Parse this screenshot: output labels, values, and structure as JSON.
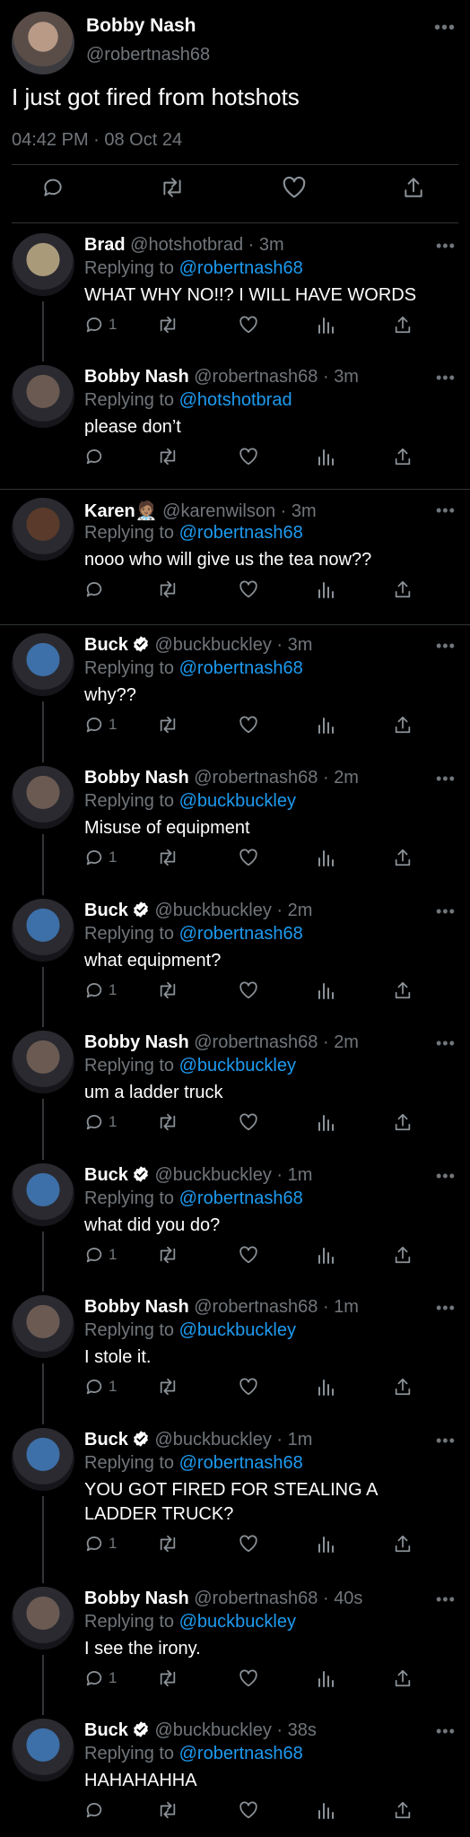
{
  "main_tweet": {
    "name": "Bobby Nash",
    "handle": "@robertnash68",
    "text": "I just got fired from hotshots",
    "timestamp": "04:42 PM · 08 Oct 24",
    "actions": [
      "reply-icon",
      "retweet-icon",
      "like-icon",
      "share-icon"
    ]
  },
  "replies": [
    {
      "name": "Brad",
      "handle": "@hotshotbrad · 3m",
      "verified": false,
      "reply_prefix": "Replying to ",
      "reply_to": "@robertnash68",
      "text": "WHAT WHY NO!!? I WILL HAVE WORDS",
      "reply_count": "1",
      "avatar_color": "#a99a7a"
    },
    {
      "name": "Bobby Nash",
      "handle": "@robertnash68 · 3m",
      "verified": false,
      "reply_prefix": "Replying to ",
      "reply_to": "@hotshotbrad",
      "text": "please don’t",
      "reply_count": "",
      "avatar_color": "#6a5a52"
    },
    {
      "name": "Karen",
      "emoji": "🧑🏽‍⚕️",
      "handle": "@karenwilson · 3m",
      "verified": false,
      "reply_prefix": "Replying to ",
      "reply_to": "@robertnash68",
      "text": "nooo who will give us the tea now??",
      "reply_count": "",
      "avatar_color": "#5a3a2a"
    },
    {
      "name": "Buck",
      "handle": "@buckbuckley · 3m",
      "verified": true,
      "reply_prefix": "Replying to ",
      "reply_to": "@robertnash68",
      "text": "why??",
      "reply_count": "1",
      "avatar_color": "#3d6fa8"
    },
    {
      "name": "Bobby Nash",
      "handle": "@robertnash68 · 2m",
      "verified": false,
      "reply_prefix": "Replying to ",
      "reply_to": "@buckbuckley",
      "text": "Misuse of equipment",
      "reply_count": "1",
      "avatar_color": "#6a5a52"
    },
    {
      "name": "Buck",
      "handle": "@buckbuckley · 2m",
      "verified": true,
      "reply_prefix": "Replying to ",
      "reply_to": "@robertnash68",
      "text": "what equipment?",
      "reply_count": "1",
      "avatar_color": "#3d6fa8"
    },
    {
      "name": "Bobby Nash",
      "handle": "@robertnash68 · 2m",
      "verified": false,
      "reply_prefix": "Replying to ",
      "reply_to": "@buckbuckley",
      "text": "um a ladder truck",
      "reply_count": "1",
      "avatar_color": "#6a5a52"
    },
    {
      "name": "Buck",
      "handle": "@buckbuckley · 1m",
      "verified": true,
      "reply_prefix": "Replying to ",
      "reply_to": "@robertnash68",
      "text": "what did you do?",
      "reply_count": "1",
      "avatar_color": "#3d6fa8"
    },
    {
      "name": "Bobby Nash",
      "handle": "@robertnash68 · 1m",
      "verified": false,
      "reply_prefix": "Replying to ",
      "reply_to": "@buckbuckley",
      "text": "I stole it.",
      "reply_count": "1",
      "avatar_color": "#6a5a52"
    },
    {
      "name": "Buck",
      "handle": "@buckbuckley · 1m",
      "verified": true,
      "reply_prefix": "Replying to ",
      "reply_to": "@robertnash68",
      "text": "YOU GOT FIRED FOR STEALING A LADDER TRUCK?",
      "reply_count": "1",
      "avatar_color": "#3d6fa8"
    },
    {
      "name": "Bobby Nash",
      "handle": "@robertnash68 · 40s",
      "verified": false,
      "reply_prefix": "Replying to ",
      "reply_to": "@buckbuckley",
      "text": "I see the irony.",
      "reply_count": "1",
      "avatar_color": "#6a5a52"
    },
    {
      "name": "Buck",
      "handle": "@buckbuckley · 38s",
      "verified": true,
      "reply_prefix": "Replying to ",
      "reply_to": "@robertnash68",
      "text": "HAHAHAHHA",
      "reply_count": "",
      "avatar_color": "#3d6fa8"
    }
  ],
  "colors": {
    "background": "#000000",
    "text": "#e7e9ea",
    "secondary": "#71767b",
    "link": "#1d9bf0",
    "verified": "#ffffff"
  }
}
